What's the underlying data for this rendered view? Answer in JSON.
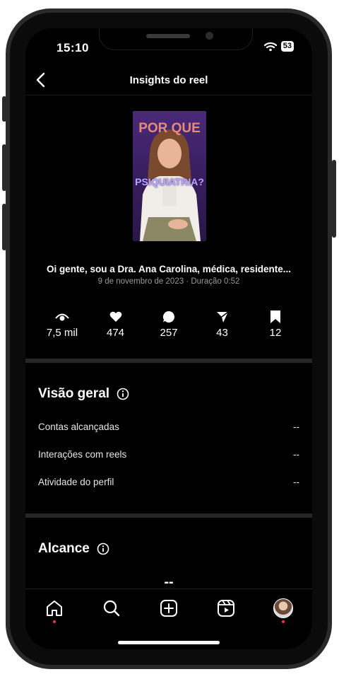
{
  "status": {
    "time": "15:10",
    "battery": "53"
  },
  "header": {
    "title": "Insights do reel"
  },
  "reel": {
    "thumb_text_top": "POR QUE",
    "thumb_text_mid": "PSIQUIATRIA?",
    "caption": "Oi gente, sou a Dra. Ana Carolina, médica, residente...",
    "meta": "9 de novembro de 2023 · Duração 0:52"
  },
  "stats": [
    {
      "icon": "eye-icon",
      "value": "7,5 mil"
    },
    {
      "icon": "heart-icon",
      "value": "474"
    },
    {
      "icon": "comment-icon",
      "value": "257"
    },
    {
      "icon": "share-icon",
      "value": "43"
    },
    {
      "icon": "bookmark-icon",
      "value": "12"
    }
  ],
  "overview": {
    "title": "Visão geral",
    "rows": [
      {
        "label": "Contas alcançadas",
        "value": "--"
      },
      {
        "label": "Interações com reels",
        "value": "--"
      },
      {
        "label": "Atividade do perfil",
        "value": "--"
      }
    ]
  },
  "reach": {
    "title": "Alcance",
    "value": "--"
  },
  "nav": [
    "home-icon",
    "search-icon",
    "create-icon",
    "reels-icon",
    "profile-avatar"
  ],
  "colors": {
    "background": "#000000",
    "notification_dot": "#ff3040",
    "thumbnail_purple": "#3a1f61"
  }
}
